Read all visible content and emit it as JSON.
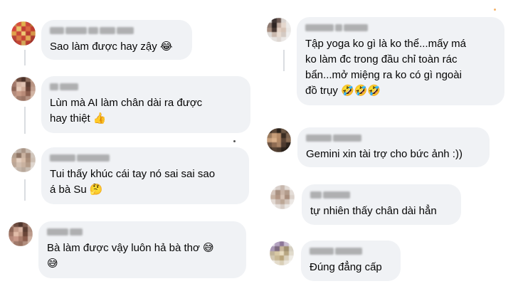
{
  "comments_left": [
    {
      "text": "Sao làm được hay zậy 😂"
    },
    {
      "text": "Lùn mà AI làm chân dài ra được\nhay thiệt 👍"
    },
    {
      "text": "Tui thấy khúc cái tay nó sai sai sao\ná bà Su 🤔"
    },
    {
      "text": "Bà làm được vậy luôn hả bà thơ 😅\n😅"
    }
  ],
  "comments_right": [
    {
      "text": "Tập yoga ko gì là ko thể...mấy má\nko làm đc trong đầu chỉ toàn rác\nbẩn...mở miệng ra ko có gì ngoài\nđồ trụy 🤣🤣🤣"
    },
    {
      "text": "Gemini xin tài trợ cho bức ảnh :))"
    },
    {
      "text": "tự nhiên thấy chân dài hẳn"
    },
    {
      "text": "Đúng đẳng cấp"
    }
  ],
  "colors": {
    "bubble_bg": "#f0f2f5",
    "thread_line": "#dadde1",
    "accent_dot": "#f4b36b"
  }
}
